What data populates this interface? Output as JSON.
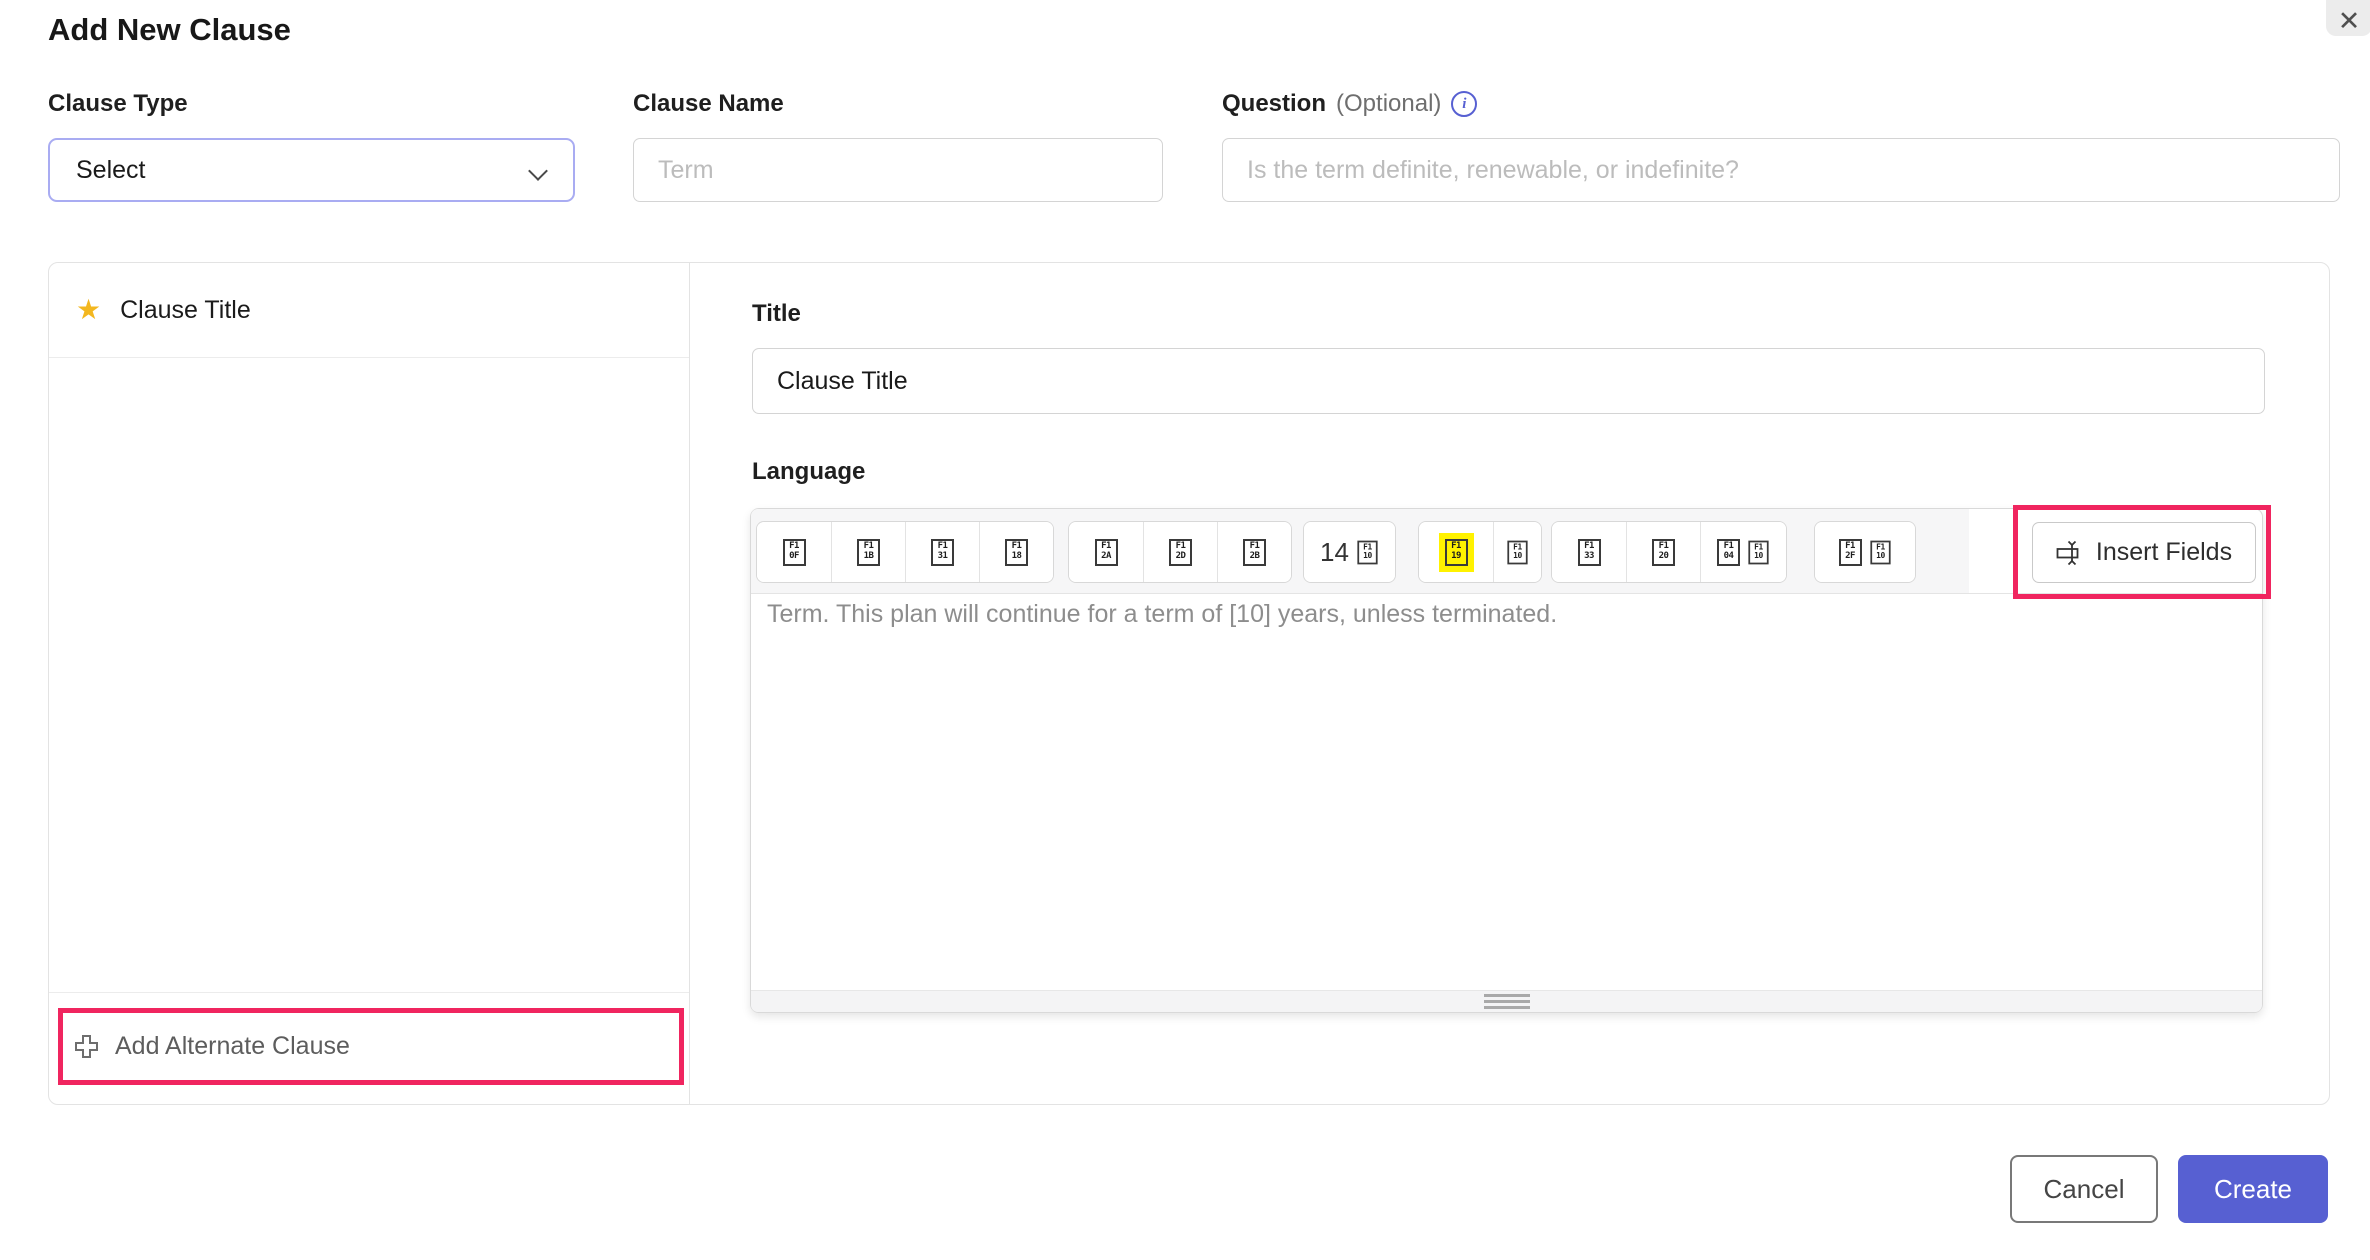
{
  "modal": {
    "title": "Add New Clause",
    "close_icon": "✕"
  },
  "form": {
    "clause_type": {
      "label": "Clause Type",
      "value": "Select"
    },
    "clause_name": {
      "label": "Clause Name",
      "placeholder": "Term"
    },
    "question": {
      "label": "Question",
      "optional": "(Optional)",
      "info_icon": "i",
      "placeholder": "Is the term definite, renewable, or indefinite?"
    }
  },
  "clause_list": {
    "items": [
      {
        "label": "Clause Title",
        "star_icon": "★"
      }
    ],
    "add_alternate_label": "Add Alternate Clause"
  },
  "detail": {
    "title_field": {
      "label": "Title",
      "value": "Clause Title"
    },
    "language_label": "Language",
    "editor": {
      "toolbar": {
        "groups": [
          {
            "buttons": [
              {
                "parts": [
                  {
                    "type": "tofu",
                    "hex": [
                      "F1",
                      "0F"
                    ]
                  }
                ]
              },
              {
                "parts": [
                  {
                    "type": "tofu",
                    "hex": [
                      "F1",
                      "1B"
                    ]
                  }
                ]
              },
              {
                "parts": [
                  {
                    "type": "tofu",
                    "hex": [
                      "F1",
                      "31"
                    ]
                  }
                ]
              },
              {
                "parts": [
                  {
                    "type": "tofu",
                    "hex": [
                      "F1",
                      "18"
                    ]
                  }
                ]
              }
            ]
          },
          {
            "buttons": [
              {
                "parts": [
                  {
                    "type": "tofu",
                    "hex": [
                      "F1",
                      "2A"
                    ]
                  }
                ]
              },
              {
                "parts": [
                  {
                    "type": "tofu",
                    "hex": [
                      "F1",
                      "2D"
                    ]
                  }
                ]
              },
              {
                "parts": [
                  {
                    "type": "tofu",
                    "hex": [
                      "F1",
                      "2B"
                    ]
                  }
                ]
              }
            ]
          },
          {
            "buttons": [
              {
                "name": "font-size-button",
                "parts": [
                  {
                    "type": "text",
                    "value": "14"
                  },
                  {
                    "type": "tofu",
                    "hex": [
                      "F1",
                      "10"
                    ],
                    "small": true
                  }
                ]
              }
            ]
          },
          {
            "buttons": [
              {
                "name": "highlight-color-button",
                "parts": [
                  {
                    "type": "tofu",
                    "hex": [
                      "F1",
                      "19"
                    ],
                    "highlight": true
                  }
                ]
              },
              {
                "name": "highlight-color-dropdown",
                "narrow": true,
                "parts": [
                  {
                    "type": "tofu",
                    "hex": [
                      "F1",
                      "10"
                    ],
                    "small": true
                  }
                ]
              }
            ]
          },
          {
            "buttons": [
              {
                "parts": [
                  {
                    "type": "tofu",
                    "hex": [
                      "F1",
                      "33"
                    ]
                  }
                ]
              },
              {
                "parts": [
                  {
                    "type": "tofu",
                    "hex": [
                      "F1",
                      "20"
                    ]
                  }
                ]
              },
              {
                "parts": [
                  {
                    "type": "tofu",
                    "hex": [
                      "F1",
                      "04"
                    ]
                  },
                  {
                    "type": "tofu",
                    "hex": [
                      "F1",
                      "10"
                    ],
                    "small": true
                  }
                ]
              }
            ]
          },
          {
            "buttons": [
              {
                "wide": true,
                "parts": [
                  {
                    "type": "tofu",
                    "hex": [
                      "F1",
                      "2F"
                    ]
                  },
                  {
                    "type": "tofu",
                    "hex": [
                      "F1",
                      "10"
                    ],
                    "small": true
                  }
                ]
              }
            ]
          }
        ],
        "insert_fields": {
          "label": "Insert Fields"
        }
      },
      "content": "Term. This plan will continue for a term of [10] years, unless terminated."
    }
  },
  "footer": {
    "cancel": "Cancel",
    "create": "Create"
  },
  "colors": {
    "primary": "#5760D2",
    "annotation_pink": "#F0255F",
    "highlight_yellow": "#FFF200",
    "star_yellow": "#F3B71F",
    "focused_select_border": "#A9ACF2"
  }
}
